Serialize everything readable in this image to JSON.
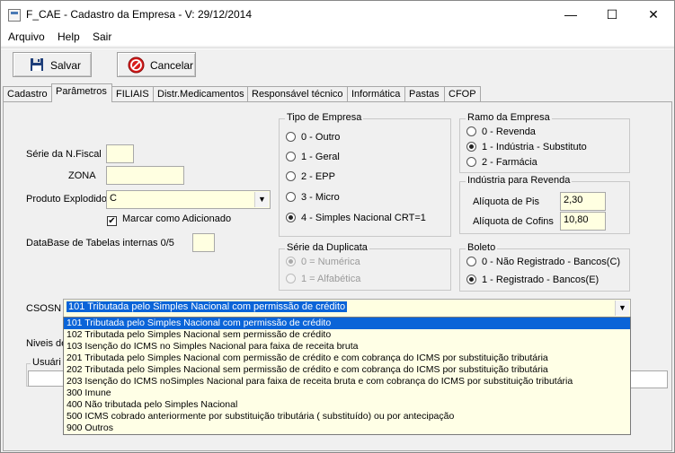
{
  "window": {
    "title": "F_CAE - Cadastro da Empresa - V: 29/12/2014",
    "minimize_glyph": "—",
    "maximize_glyph": "☐",
    "close_glyph": "✕"
  },
  "menu": [
    "Arquivo",
    "Help",
    "Sair"
  ],
  "toolbar": {
    "save_label": "Salvar",
    "cancel_label": "Cancelar"
  },
  "tabs": [
    "Cadastro",
    "Parâmetros",
    "FILIAIS",
    "Distr.Medicamentos",
    "Responsável técnico",
    "Informática",
    "Pastas",
    "CFOP"
  ],
  "active_tab": "Parâmetros",
  "form": {
    "serie_nfiscal_label": "Série da N.Fiscal",
    "serie_nfiscal_value": "",
    "zona_label": "ZONA",
    "zona_value": "",
    "produto_explodido_label": "Produto Explodido",
    "produto_explodido_value": "C",
    "marcar_adicionado_label": "Marcar como Adicionado",
    "marcar_adicionado_checked": true,
    "database_label": "DataBase de Tabelas internas 0/5",
    "database_value": "",
    "csosn_label": "CSOSN",
    "csosn_value": "101 Tributada pelo Simples Nacional com permissão de crédito",
    "niveis_label": "Niveis de",
    "usuario_label": "Usuári"
  },
  "tipo_empresa": {
    "title": "Tipo de Empresa",
    "options": [
      "0 - Outro",
      "1 - Geral",
      "2 - EPP",
      "3 - Micro",
      "4 - Simples Nacional CRT=1"
    ],
    "selected": 4
  },
  "ramo_empresa": {
    "title": "Ramo da Empresa",
    "options": [
      "0 - Revenda",
      "1 - Indústria - Substituto",
      "2 - Farmácia"
    ],
    "selected": 1
  },
  "industria_revenda": {
    "title": "Indústria para Revenda",
    "pis_label": "Alíquota de Pis",
    "pis_value": "2,30",
    "cofins_label": "Alíquota de Cofins",
    "cofins_value": "10,80"
  },
  "serie_duplicata": {
    "title": "Série da Duplicata",
    "options": [
      "0 = Numérica",
      "1 = Alfabética"
    ],
    "selected": 0
  },
  "boleto": {
    "title": "Boleto",
    "options": [
      "0 - Não Registrado - Bancos(C)",
      "1 - Registrado - Bancos(E)"
    ],
    "selected": 1
  },
  "csosn_options": [
    "101 Tributada pelo Simples Nacional com permissão de crédito",
    "102 Tributada pelo Simples Nacional sem permissão de crédito",
    "103 Isenção do ICMS no Simples Nacional para faixa de receita bruta",
    "201 Tributada pelo Simples Nacional com permissão de crédito e com cobrança do ICMS por substituição tributária",
    "202 Tributada pelo Simples Nacional sem permissão de crédito e com cobrança do ICMS por substituição tributária",
    "203 Isenção do ICMS noSimples Nacional para faixa de receita bruta e com cobrança do ICMS por substituição tributária",
    "300 Imune",
    "400 Não tributada pelo Simples Nacional",
    "500 ICMS cobrado anteriormente por substituição tributária ( substituído) ou por antecipação",
    "900 Outros"
  ],
  "csosn_highlighted": 0,
  "colors": {
    "input_bg": "#ffffe1",
    "highlight": "#0a64d8",
    "cancel_icon": "#d81c1c",
    "save_icon": "#1f3f7a"
  }
}
